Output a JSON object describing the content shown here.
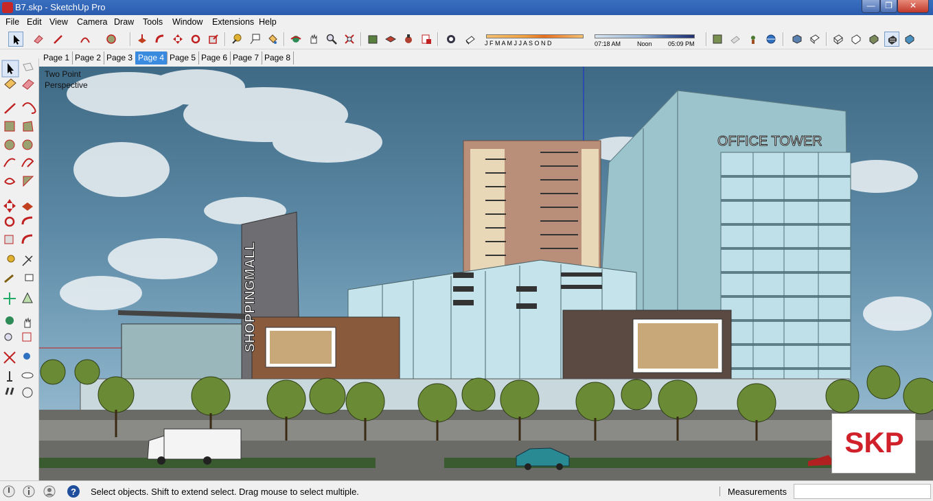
{
  "window": {
    "title": "B7.skp - SketchUp Pro"
  },
  "menu": {
    "items": [
      "File",
      "Edit",
      "View",
      "Camera",
      "Draw",
      "Tools",
      "Window",
      "Extensions",
      "Help"
    ]
  },
  "shadows": {
    "months": "J F M A M J J A S O N D",
    "time_start": "07:18 AM",
    "time_mid": "Noon",
    "time_end": "05:09 PM"
  },
  "scenes": {
    "tabs": [
      "Page 1",
      "Page 2",
      "Page 3",
      "Page 4",
      "Page 5",
      "Page 6",
      "Page 7",
      "Page 8"
    ],
    "active_index": 3
  },
  "viewport": {
    "camera_label_line1": "Two Point",
    "camera_label_line2": "Perspective",
    "sign_office": "OFFICE TOWER",
    "sign_mall": "SHOPPINGMALL",
    "watermark": "SKP",
    "colors": {
      "sky": "#5d8aa6",
      "skp_red": "#d0202a",
      "glass": "#bfe0e8"
    }
  },
  "status": {
    "message": "Select objects. Shift to extend select. Drag mouse to select multiple.",
    "measurements_label": "Measurements",
    "measurements_value": ""
  },
  "icons": {
    "toolbar": [
      "select-icon",
      "eraser-icon",
      "line-icon",
      "arc-icon",
      "circle-icon",
      "push-pull-icon",
      "follow-me-icon",
      "move-icon",
      "rotate-icon",
      "scale-icon",
      "tape-icon",
      "text-icon",
      "paint-icon",
      "orbit-icon",
      "pan-icon",
      "zoom-icon",
      "zoom-extents-icon",
      "warehouse-icon",
      "components-icon",
      "styles-icon",
      "layout-icon",
      "section-icon",
      "shadow-toggle-icon",
      "fog-icon",
      "geolocate-icon",
      "iso-view-icon",
      "top-view-icon",
      "front-view-icon",
      "right-view-icon",
      "back-view-icon",
      "left-view-icon",
      "xray-icon",
      "wireframe-icon",
      "hidden-line-icon",
      "shaded-icon",
      "textured-icon",
      "monochrome-icon"
    ]
  }
}
